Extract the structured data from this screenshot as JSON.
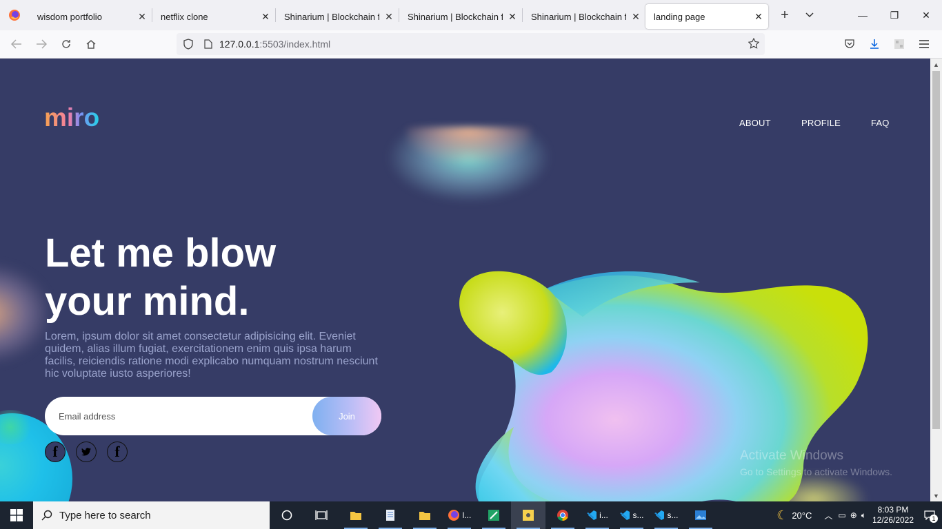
{
  "browser": {
    "tabs": [
      {
        "label": "wisdom portfolio",
        "active": false
      },
      {
        "label": "netflix clone",
        "active": false
      },
      {
        "label": "Shinarium | Blockchain for",
        "active": false
      },
      {
        "label": "Shinarium | Blockchain for",
        "active": false
      },
      {
        "label": "Shinarium | Blockchain for",
        "active": false
      },
      {
        "label": "landing page",
        "active": true
      }
    ],
    "url_host": "127.0.0.1",
    "url_rest": ":5503/index.html"
  },
  "page": {
    "logo": "miro",
    "menu": [
      "ABOUT",
      "PROFILE",
      "FAQ"
    ],
    "hero": {
      "title_line1": "Let me blow",
      "title_line2": "your mind.",
      "text": "Lorem, ipsum dolor sit amet consectetur adipisicing elit. Eveniet quidem, alias illum fugiat, exercitationem enim quis ipsa harum facilis, reiciendis ratione modi explicabo numquam nostrum nesciunt hic voluptate iusto asperiores!"
    },
    "form": {
      "placeholder": "Email address",
      "button": "Join"
    },
    "socials": [
      "facebook-icon",
      "twitter-icon",
      "facebook-icon"
    ],
    "watermark_title": "Activate Windows",
    "watermark_sub": "Go to Settings to activate Windows."
  },
  "taskbar": {
    "search_placeholder": "Type here to search",
    "weather": "20°C",
    "time": "8:03 PM",
    "date": "12/26/2022",
    "notifications": "1",
    "app_labels": {
      "firefox": "l...",
      "vscode1": "i...",
      "vscode2": "s...",
      "vscode3": "s..."
    }
  },
  "colors": {
    "page_bg": "#363c66",
    "taskbar": "#1c2430",
    "tab_bar": "#f0f0f4"
  }
}
